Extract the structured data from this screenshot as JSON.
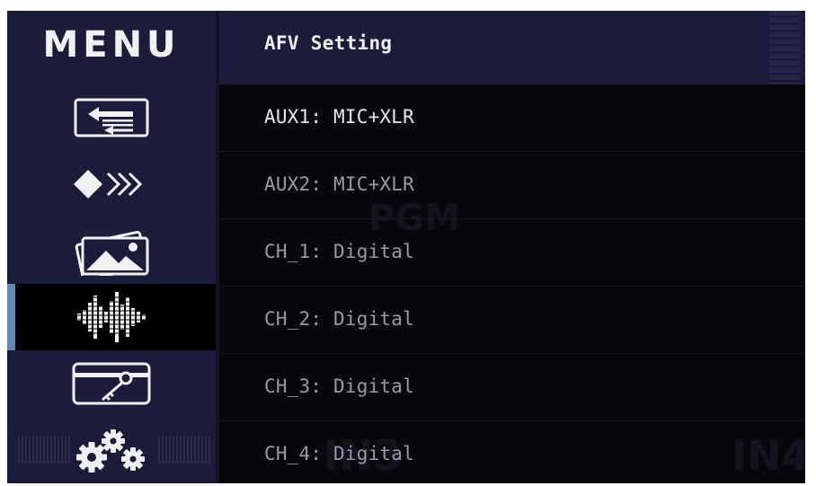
{
  "menu": {
    "title": "MENU"
  },
  "sidebar": {
    "items": [
      {
        "id": "input-select",
        "icon": "input-switch-icon"
      },
      {
        "id": "transition",
        "icon": "transition-arrows-icon"
      },
      {
        "id": "media",
        "icon": "image-gallery-icon"
      },
      {
        "id": "audio",
        "icon": "audio-waveform-icon",
        "active": true
      },
      {
        "id": "access",
        "icon": "key-card-icon"
      },
      {
        "id": "settings",
        "icon": "gears-icon"
      }
    ]
  },
  "header": {
    "title": "AFV Setting"
  },
  "list": {
    "items": [
      {
        "label": "AUX1: MIC+XLR",
        "selected": true
      },
      {
        "label": "AUX2: MIC+XLR"
      },
      {
        "label": "CH_1: Digital"
      },
      {
        "label": "CH_2: Digital"
      },
      {
        "label": "CH_3: Digital"
      },
      {
        "label": "CH_4: Digital"
      }
    ]
  },
  "background_labels": {
    "pgm": "PGM",
    "in3": "IN3",
    "in4": "IN4"
  },
  "colors": {
    "sidebar_bg": "#1b1b3b",
    "content_bg": "#07070c",
    "active_indicator": "#5d8ab8",
    "text_primary": "#f0f0f0",
    "text_dim": "#9a9aa2"
  }
}
